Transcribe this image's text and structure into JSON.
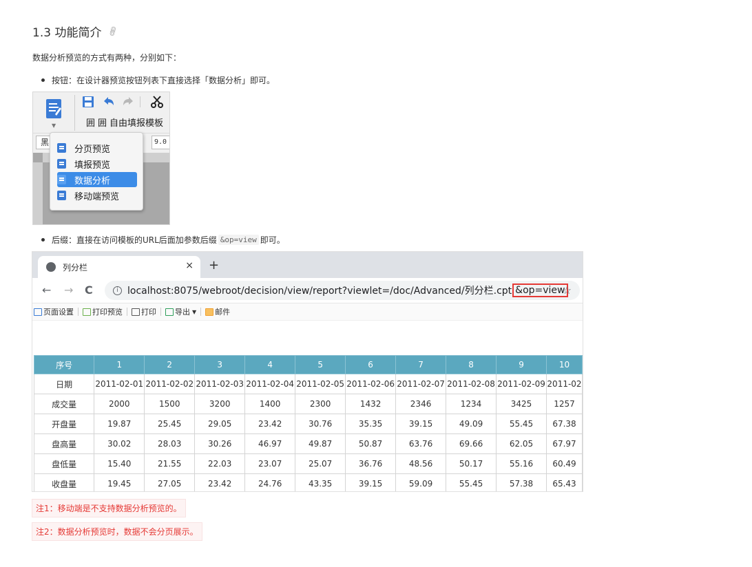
{
  "section": {
    "title": "1.3 功能简介",
    "intro": "数据分析预览的方式有两种，分别如下：",
    "bullet1": "按钮：在设计器预览按钮列表下直接选择「数据分析」即可。",
    "bullet2_pre": "后缀：直接在访问模板的URL后面加参数后缀",
    "bullet2_code": "&op=view",
    "bullet2_post": "即可。"
  },
  "designer": {
    "row2_icons": [
      "囲",
      "囲"
    ],
    "row2_text": "自由填报模板",
    "font_box": "黑",
    "size_box": "9.0",
    "menu": [
      {
        "label": "分页预览",
        "active": false
      },
      {
        "label": "填报预览",
        "active": false
      },
      {
        "label": "数据分析",
        "active": true
      },
      {
        "label": "移动端预览",
        "active": false
      }
    ]
  },
  "browser": {
    "tab_title": "列分栏",
    "tab_close": "×",
    "new_tab": "+",
    "back": "←",
    "forward": "→",
    "reload": "C",
    "url_main": "localhost:8075/webroot/decision/view/report?viewlet=/doc/Advanced/列分栏.cpt",
    "url_param": "&op=view",
    "star": "☆",
    "toolbar": [
      "页面设置",
      "打印预览",
      "打印",
      "导出",
      "邮件"
    ]
  },
  "table": {
    "header": [
      "序号",
      "1",
      "2",
      "3",
      "4",
      "5",
      "6",
      "7",
      "8",
      "9",
      "10"
    ],
    "rows": [
      [
        "日期",
        "2011-02-01",
        "2011-02-02",
        "2011-02-03",
        "2011-02-04",
        "2011-02-05",
        "2011-02-06",
        "2011-02-07",
        "2011-02-08",
        "2011-02-09",
        "2011-02"
      ],
      [
        "成交量",
        "2000",
        "1500",
        "3200",
        "1400",
        "2300",
        "1432",
        "2346",
        "1234",
        "3425",
        "1257"
      ],
      [
        "开盘量",
        "19.87",
        "25.45",
        "29.05",
        "23.42",
        "30.76",
        "35.35",
        "39.15",
        "49.09",
        "55.45",
        "67.38"
      ],
      [
        "盘高量",
        "30.02",
        "28.03",
        "30.26",
        "46.97",
        "49.87",
        "50.87",
        "63.76",
        "69.66",
        "62.05",
        "67.97"
      ],
      [
        "盘低量",
        "15.40",
        "21.55",
        "22.03",
        "23.07",
        "25.07",
        "36.76",
        "48.56",
        "50.17",
        "55.16",
        "60.49"
      ],
      [
        "收盘量",
        "19.45",
        "27.05",
        "23.42",
        "24.76",
        "43.35",
        "39.15",
        "59.09",
        "55.45",
        "57.38",
        "65.43"
      ]
    ]
  },
  "notes": {
    "note1": "注1：移动端是不支持数据分析预览的。",
    "note2": "注2：数据分析预览时，数据不会分页展示。"
  },
  "colors": {
    "table_header": "#5ba8bf",
    "note_text": "#e53935",
    "menu_active": "#3c8ce7"
  }
}
